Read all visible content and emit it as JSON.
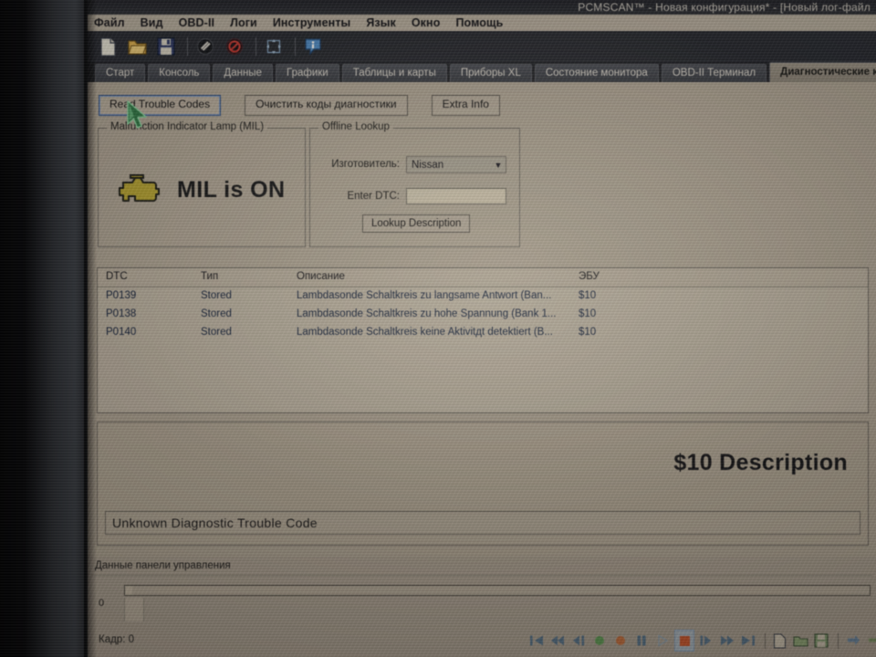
{
  "window": {
    "title": "PCMSCAN™ - Новая конфигурация* - [Новый лог-файл"
  },
  "menubar": {
    "items": [
      {
        "label": "Файл"
      },
      {
        "label": "Вид"
      },
      {
        "label": "OBD-II"
      },
      {
        "label": "Логи"
      },
      {
        "label": "Инструменты"
      },
      {
        "label": "Язык"
      },
      {
        "label": "Окно"
      },
      {
        "label": "Помощь"
      }
    ]
  },
  "toolbar": {
    "icons": [
      {
        "name": "new-document-icon"
      },
      {
        "name": "open-folder-icon"
      },
      {
        "name": "save-floppy-icon"
      },
      {
        "name": "connect-icon"
      },
      {
        "name": "disconnect-icon"
      },
      {
        "name": "fullscreen-icon"
      },
      {
        "name": "info-icon"
      }
    ]
  },
  "tabs": [
    {
      "label": "Старт",
      "active": false
    },
    {
      "label": "Консоль",
      "active": false
    },
    {
      "label": "Данные",
      "active": false
    },
    {
      "label": "Графики",
      "active": false
    },
    {
      "label": "Таблицы и карты",
      "active": false
    },
    {
      "label": "Приборы XL",
      "active": false
    },
    {
      "label": "Состояние монитора",
      "active": false
    },
    {
      "label": "OBD-II Терминал",
      "active": false
    },
    {
      "label": "Диагностические коды",
      "active": true
    }
  ],
  "actions": {
    "read_codes": "Read Trouble Codes",
    "clear_codes": "Очистить коды диагностики",
    "extra_info": "Extra Info"
  },
  "mil": {
    "legend": "Malfunction Indicator Lamp (MIL)",
    "status": "MIL is ON",
    "lamp_color": "#b8a52a"
  },
  "lookup": {
    "legend": "Offline Lookup",
    "manufacturer_label": "Изготовитель:",
    "manufacturer_value": "Nissan",
    "dtc_label": "Enter DTC:",
    "dtc_value": "",
    "dtc_placeholder": "",
    "button": "Lookup Description"
  },
  "dtc_table": {
    "columns": [
      "DTC",
      "Тип",
      "Описание",
      "ЭБУ"
    ],
    "rows": [
      {
        "dtc": "P0139",
        "type": "Stored",
        "description": "Lambdasonde Schaltkreis zu langsame Antwort (Ban...",
        "ecu": "$10"
      },
      {
        "dtc": "P0138",
        "type": "Stored",
        "description": "Lambdasonde Schaltkreis zu hohe Spannung (Bank 1...",
        "ecu": "$10"
      },
      {
        "dtc": "P0140",
        "type": "Stored",
        "description": "Lambdasonde Schaltkreis keine Aktivitдt detektiert (B...",
        "ecu": "$10"
      }
    ]
  },
  "description_panel": {
    "title": "$10 Description",
    "text": "Unknown Diagnostic Trouble Code"
  },
  "dock": {
    "title": "Данные панели управления",
    "zero_label": "0",
    "frame_label": "Кадр:  0",
    "transport": [
      {
        "name": "skip-to-start-icon"
      },
      {
        "name": "rewind-icon"
      },
      {
        "name": "step-back-icon"
      },
      {
        "name": "record-green-icon"
      },
      {
        "name": "record-red-icon"
      },
      {
        "name": "pause-icon"
      },
      {
        "name": "play-icon"
      },
      {
        "name": "stop-icon"
      },
      {
        "name": "step-forward-icon"
      },
      {
        "name": "fast-forward-icon"
      },
      {
        "name": "skip-to-end-icon"
      },
      {
        "name": "new-log-icon"
      },
      {
        "name": "open-log-icon"
      },
      {
        "name": "save-log-icon"
      },
      {
        "name": "export-icon"
      },
      {
        "name": "share-icon"
      }
    ]
  }
}
